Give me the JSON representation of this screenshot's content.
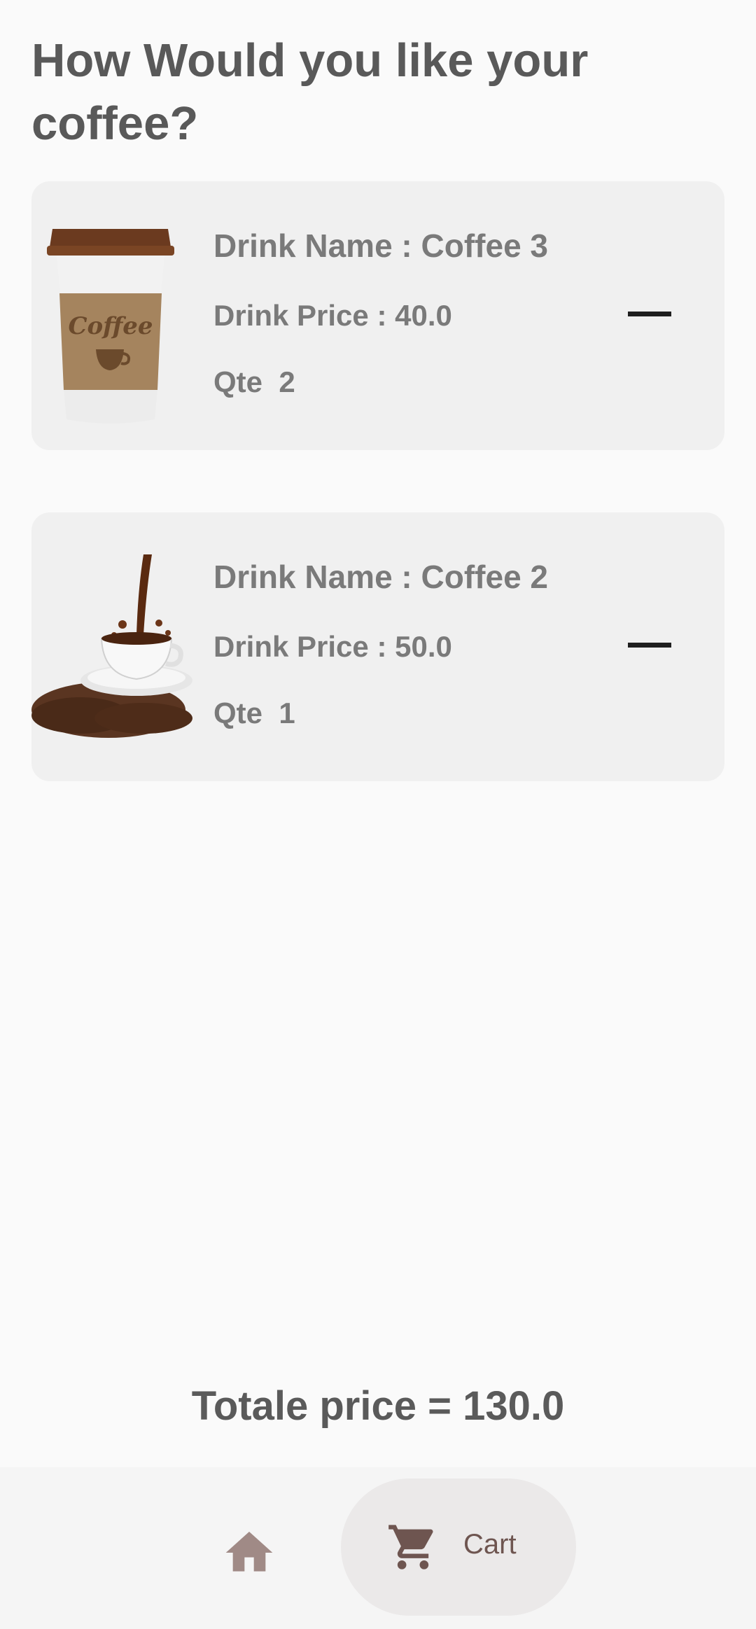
{
  "page_title": "How Would you like your coffee?",
  "cart_items": [
    {
      "name_text": "Drink Name : Coffee 3",
      "price_text": "Drink Price : 40.0",
      "qte_text": "Qte  2",
      "image_icon": "takeaway-coffee-cup"
    },
    {
      "name_text": "Drink Name : Coffee 2",
      "price_text": "Drink Price : 50.0",
      "qte_text": "Qte  1",
      "image_icon": "espresso-cup-with-beans"
    }
  ],
  "remove_icon": "minus-icon",
  "total_text": "Totale price = 130.0",
  "bottom_nav": {
    "home_icon": "home-icon",
    "cart_icon": "cart-icon",
    "cart_label": "Cart",
    "active_tab": "cart",
    "active_color": "#6e5550",
    "inactive_color": "#a08a86"
  }
}
